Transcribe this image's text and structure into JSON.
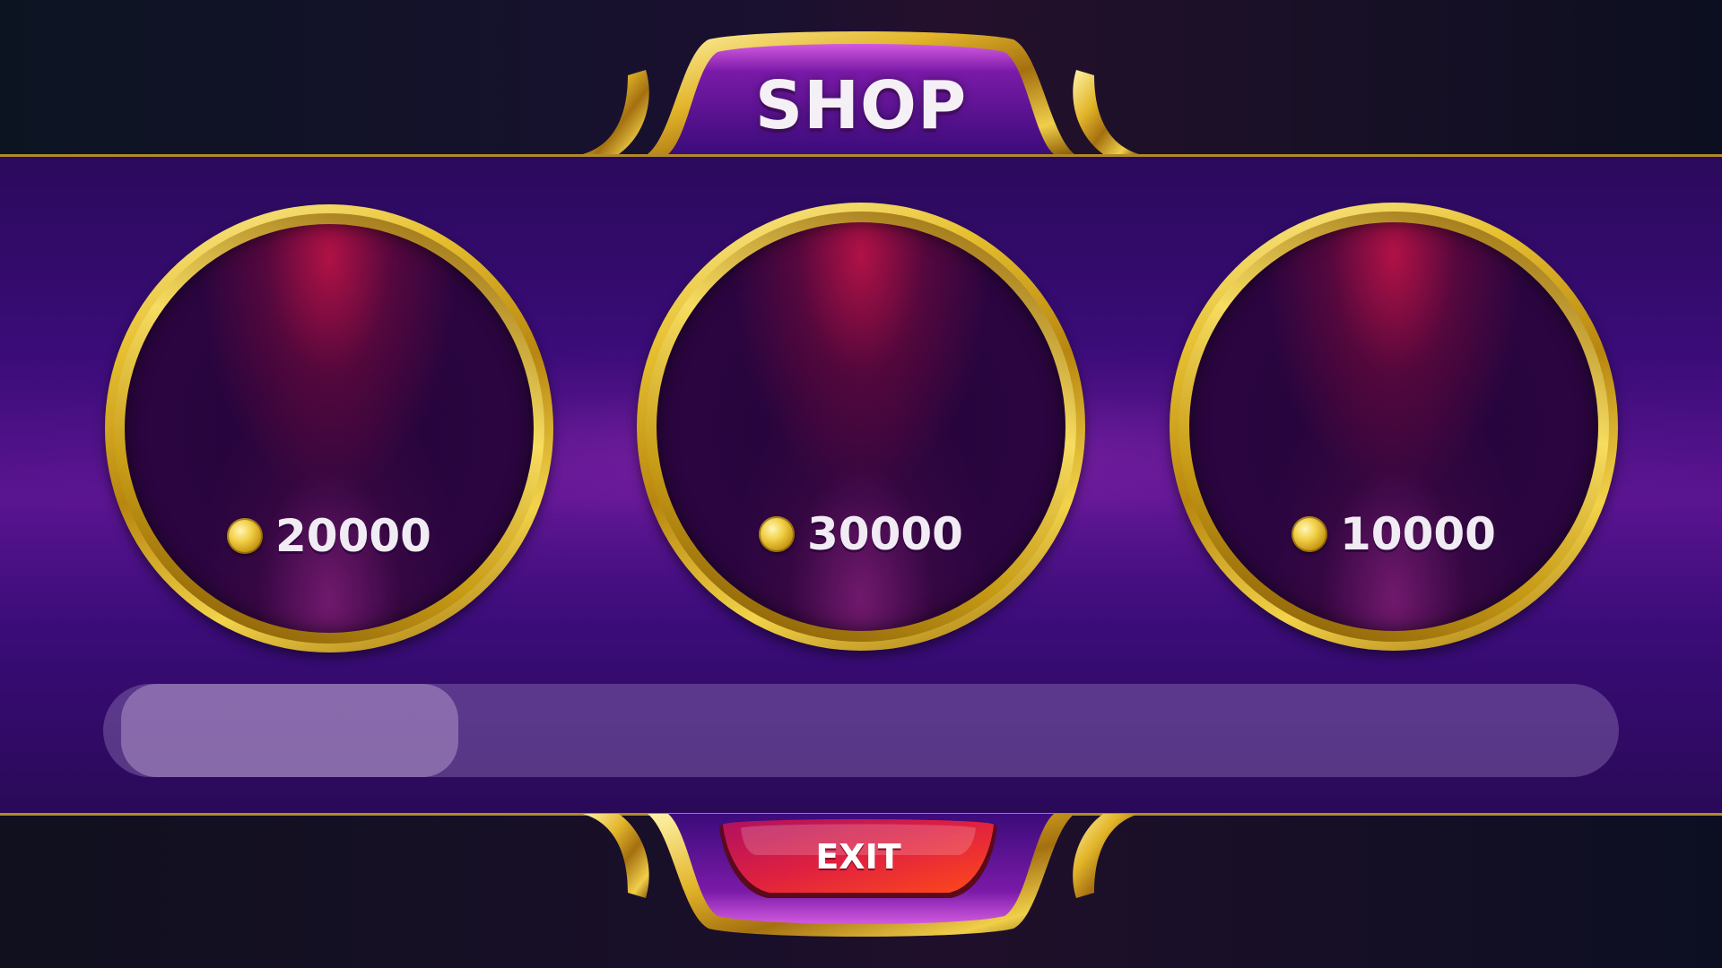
{
  "header": {
    "title": "SHOP"
  },
  "shop": {
    "items": [
      {
        "price": "20000",
        "currency_icon": "gold-coin-icon"
      },
      {
        "price": "30000",
        "currency_icon": "gold-coin-icon"
      },
      {
        "price": "10000",
        "currency_icon": "gold-coin-icon"
      }
    ],
    "scroll_position": 0.0
  },
  "footer": {
    "exit_label": "EXIT"
  },
  "colors": {
    "panel": "#3a0c78",
    "gold": "#e6c030",
    "exit_button": "#e0213f",
    "text": "#f4f0f6"
  }
}
